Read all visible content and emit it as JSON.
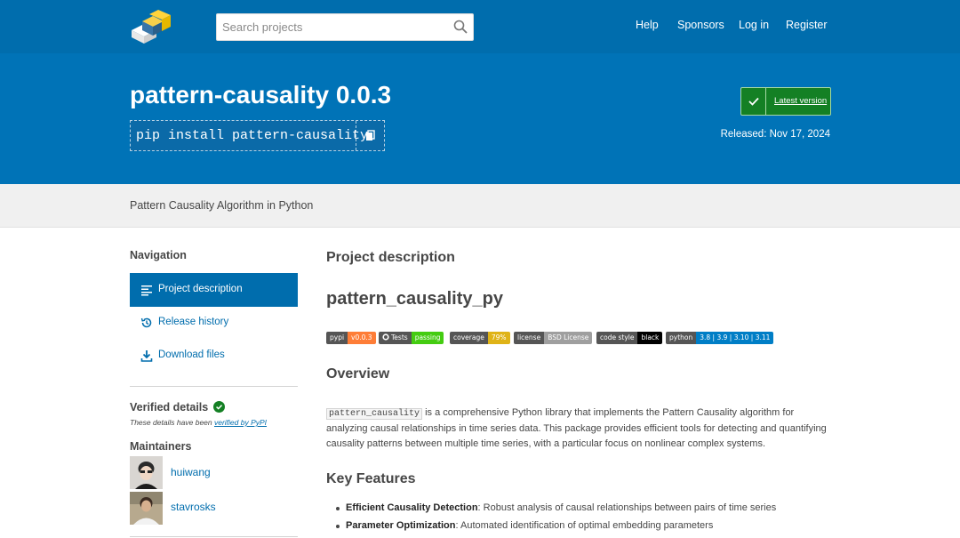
{
  "header": {
    "search_placeholder": "Search projects",
    "nav": [
      "Help",
      "Sponsors",
      "Log in",
      "Register"
    ]
  },
  "banner": {
    "title": "pattern-causality 0.0.3",
    "pip_command": "pip install pattern-causality",
    "latest_label": "Latest version",
    "released": "Released: Nov 17, 2024"
  },
  "summary": "Pattern Causality Algorithm in Python",
  "sidebar": {
    "nav_heading": "Navigation",
    "items": [
      {
        "label": "Project description",
        "icon": "align-left-icon",
        "active": true
      },
      {
        "label": "Release history",
        "icon": "history-icon",
        "active": false
      },
      {
        "label": "Download files",
        "icon": "download-icon",
        "active": false
      }
    ],
    "verified_heading": "Verified details",
    "verified_note_prefix": "These details have been ",
    "verified_link": "verified by PyPI",
    "maintainers_heading": "Maintainers",
    "maintainers": [
      "huiwang",
      "stavrosks"
    ]
  },
  "main": {
    "section_title": "Project description",
    "readme_title": "pattern_causality_py",
    "badges": [
      {
        "left": "pypi",
        "right": "v0.0.3",
        "color": "#fe7d37"
      },
      {
        "left": "Tests",
        "right": "passing",
        "color": "#4c1"
      },
      {
        "left": "coverage",
        "right": "79%",
        "color": "#dfb317"
      },
      {
        "left": "license",
        "right": "BSD License",
        "color": "#9f9f9f"
      },
      {
        "left": "code style",
        "right": "black",
        "color": "#000000"
      },
      {
        "left": "python",
        "right": "3.8 | 3.9 | 3.10 | 3.11",
        "color": "#007ec6"
      }
    ],
    "overview_heading": "Overview",
    "overview_code": "pattern_causality",
    "overview_text": " is a comprehensive Python library that implements the Pattern Causality algorithm for analyzing causal relationships in time series data. This package provides efficient tools for detecting and quantifying causality patterns between multiple time series, with a particular focus on nonlinear complex systems.",
    "features_heading": "Key Features",
    "features": [
      {
        "bold": "Efficient Causality Detection",
        "text": ": Robust analysis of causal relationships between pairs of time series"
      },
      {
        "bold": "Parameter Optimization",
        "text": ": Automated identification of optimal embedding parameters"
      }
    ]
  },
  "colors": {
    "brand_blue": "#006dad",
    "banner_blue": "#0073b7",
    "latest_green": "#148024"
  }
}
